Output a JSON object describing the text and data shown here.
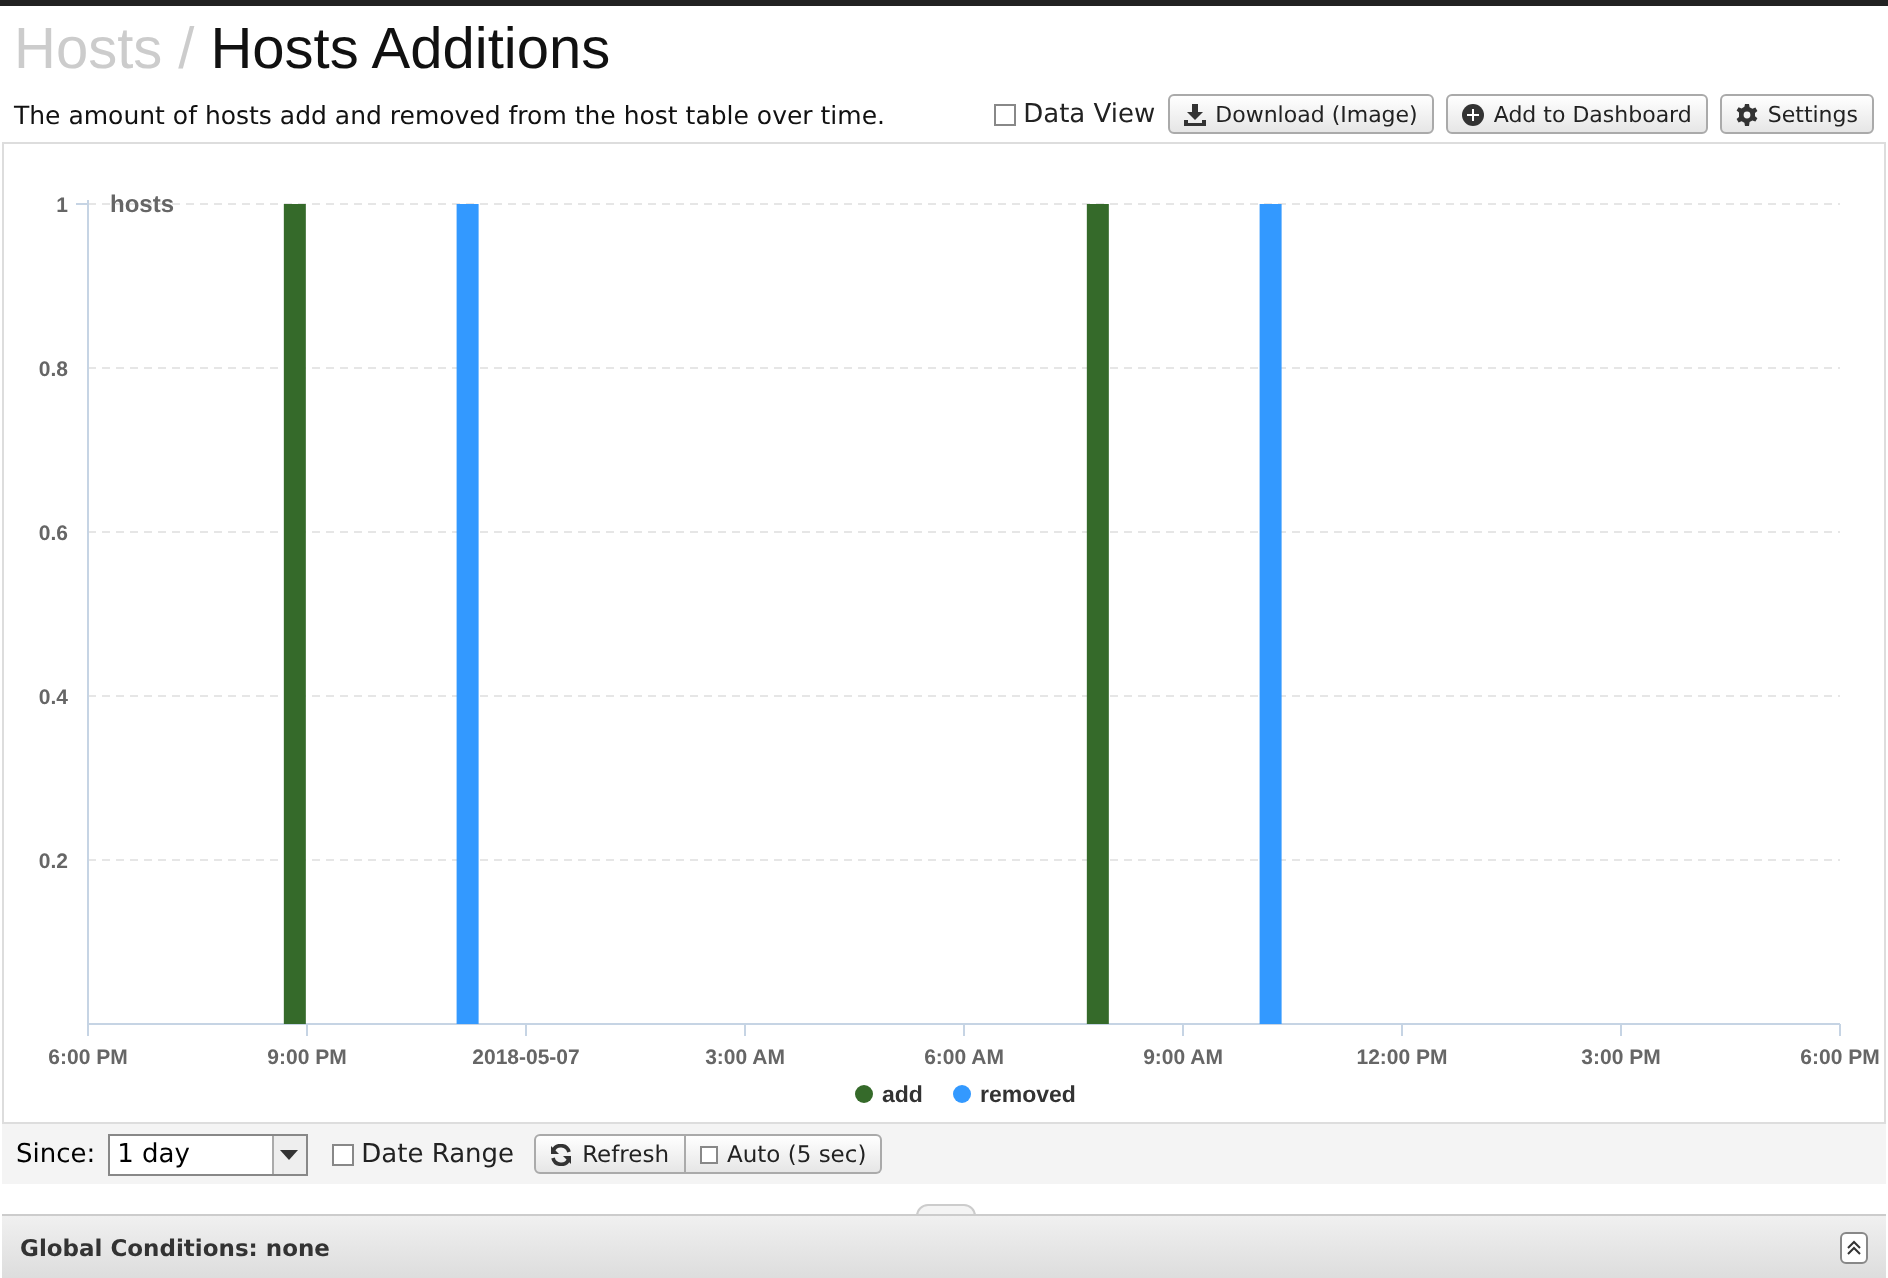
{
  "breadcrumb": {
    "parent": "Hosts",
    "separator": "/",
    "title": "Hosts Additions"
  },
  "description": "The amount of hosts add and removed from the host table over time.",
  "toolbar": {
    "data_view": {
      "label": "Data View",
      "checked": false
    },
    "buttons": [
      {
        "kind": "download",
        "label": "Download (Image)"
      },
      {
        "kind": "add",
        "label": "Add to Dashboard"
      },
      {
        "kind": "settings",
        "label": "Settings"
      }
    ]
  },
  "chart": {
    "chart_data": {
      "type": "bar",
      "ylabel": "hosts",
      "grid": "y",
      "legend": "bottom",
      "x": [
        "2018-05-06T20:50",
        "2018-05-06T23:12",
        "2018-05-07T07:50",
        "2018-05-07T10:12"
      ],
      "xlim": [
        "2018-05-06T18:00",
        "2018-05-07T18:00"
      ],
      "ylim": [
        0,
        1
      ],
      "xticks": [
        {
          "value": "2018-05-06T18:00",
          "label": "6:00 PM"
        },
        {
          "value": "2018-05-06T21:00",
          "label": "9:00 PM"
        },
        {
          "value": "2018-05-07T00:00",
          "label": "2018-05-07"
        },
        {
          "value": "2018-05-07T03:00",
          "label": "3:00 AM"
        },
        {
          "value": "2018-05-07T06:00",
          "label": "6:00 AM"
        },
        {
          "value": "2018-05-07T09:00",
          "label": "9:00 AM"
        },
        {
          "value": "2018-05-07T12:00",
          "label": "12:00 PM"
        },
        {
          "value": "2018-05-07T15:00",
          "label": "3:00 PM"
        },
        {
          "value": "2018-05-07T18:00",
          "label": "6:00 PM"
        }
      ],
      "yticks": [
        {
          "value": 0.2,
          "label": "0.2"
        },
        {
          "value": 0.4,
          "label": "0.4"
        },
        {
          "value": 0.6,
          "label": "0.6"
        },
        {
          "value": 0.8,
          "label": "0.8"
        },
        {
          "value": 1,
          "label": "1"
        }
      ],
      "series": [
        {
          "name": "add",
          "color": "#356a2a",
          "values": [
            1,
            null,
            1,
            null
          ]
        },
        {
          "name": "removed",
          "color": "#3399ff",
          "values": [
            null,
            1,
            null,
            1
          ]
        }
      ]
    }
  },
  "controls": {
    "since_label": "Since:",
    "since_value": "1 day",
    "date_range": {
      "label": "Date Range",
      "checked": false
    },
    "refresh": "Refresh",
    "auto": {
      "label": "Auto (5 sec)",
      "checked": false
    }
  },
  "footer": {
    "global_conditions": "Global Conditions: none"
  }
}
